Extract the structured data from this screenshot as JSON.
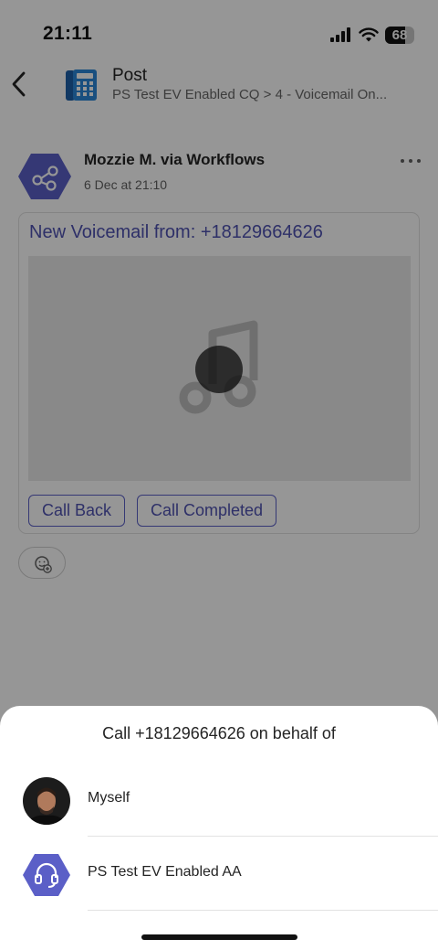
{
  "status_bar": {
    "time": "21:11",
    "battery_percent": "68",
    "battery_level": 0.68,
    "icons": [
      "signal-icon",
      "wifi-icon",
      "battery-icon"
    ]
  },
  "header": {
    "title": "Post",
    "subtitle": "PS Test EV Enabled CQ > 4 - Voicemail On...",
    "icons": [
      "back-icon",
      "phone-app-icon"
    ]
  },
  "post": {
    "author": "Mozzie M. via Workflows",
    "timestamp": "6 Dec at 21:10",
    "card": {
      "title": "New Voicemail from: +18129664626",
      "media_icon": "music-note-icon",
      "buttons": [
        "Call Back",
        "Call Completed"
      ]
    },
    "reaction_icon": "add-reaction-icon"
  },
  "sheet": {
    "title": "Call +18129664626 on behalf of",
    "options": [
      {
        "label": "Myself",
        "icon": "user-photo-avatar"
      },
      {
        "label": "PS Test EV Enabled AA",
        "icon": "headset-icon"
      }
    ]
  },
  "colors": {
    "accent": "#5b5fc7",
    "accent_text": "#4f52b2",
    "overlay": "rgba(0,0,0,0.41)"
  }
}
